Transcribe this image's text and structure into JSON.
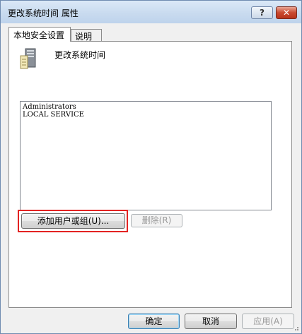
{
  "window": {
    "title": "更改系统时间 属性"
  },
  "titlebar_buttons": {
    "help_label": "?",
    "close_label": "✕"
  },
  "tabs": [
    {
      "label": "本地安全设置",
      "active": true
    },
    {
      "label": "说明",
      "active": false
    }
  ],
  "policy": {
    "icon": "server-icon",
    "name": "更改系统时间"
  },
  "accounts": [
    "Administrators",
    "LOCAL SERVICE"
  ],
  "buttons": {
    "add": "添加用户或组(U)...",
    "remove": "删除(R)",
    "ok": "确定",
    "cancel": "取消",
    "apply": "应用(A)"
  },
  "colors": {
    "highlight": "#e32322",
    "close_button": "#c9492f"
  }
}
